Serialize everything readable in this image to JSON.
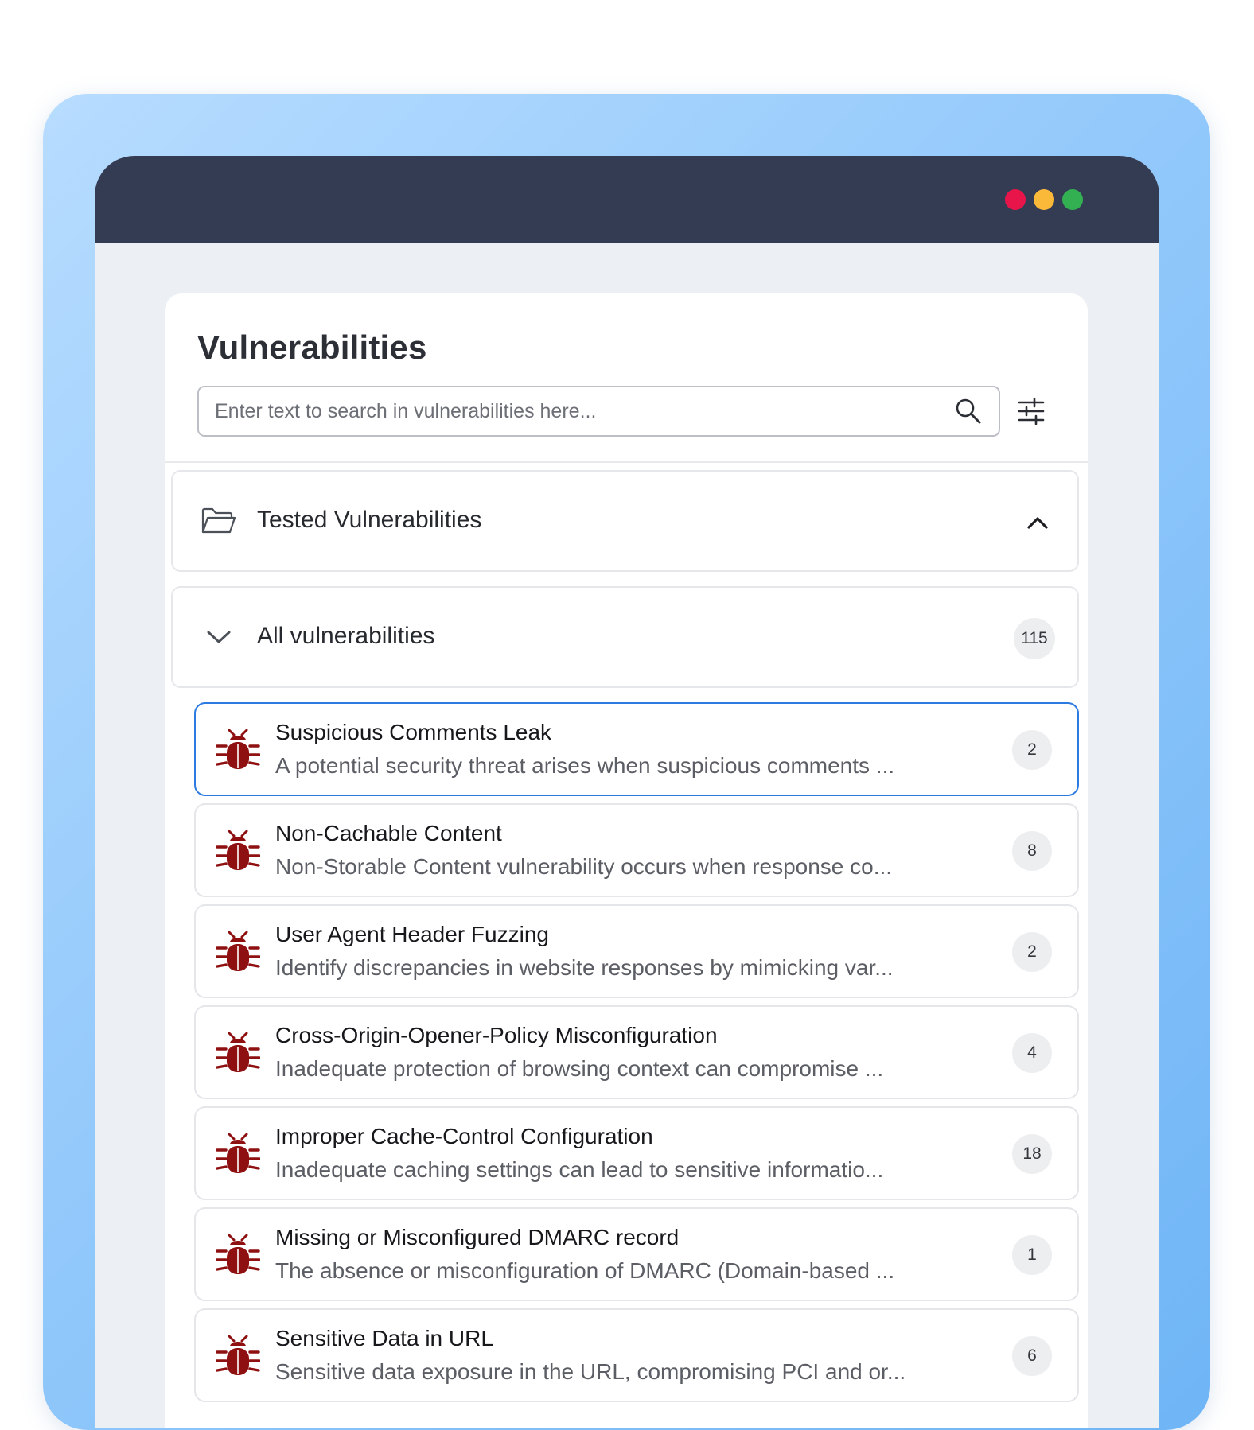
{
  "window": {
    "controls": [
      {
        "name": "close",
        "color": "#e8154a"
      },
      {
        "name": "minimize",
        "color": "#fbb93a"
      },
      {
        "name": "maximize",
        "color": "#33b052"
      }
    ]
  },
  "panel": {
    "title": "Vulnerabilities",
    "search": {
      "placeholder": "Enter text to search in vulnerabilities here...",
      "value": "",
      "icon": "search-icon"
    },
    "filter_icon": "sliders-icon"
  },
  "sections": {
    "tested": {
      "label": "Tested Vulnerabilities",
      "icon": "folder-open-icon",
      "toggle_icon": "chevron-up-icon"
    },
    "all": {
      "label": "All vulnerabilities",
      "icon": "chevron-down-icon",
      "count": "115"
    }
  },
  "vulnerabilities": [
    {
      "title": "Suspicious Comments Leak",
      "description": "A potential security threat arises when suspicious comments ...",
      "count": "2",
      "selected": true
    },
    {
      "title": "Non-Cachable Content",
      "description": "Non-Storable Content vulnerability occurs when response co...",
      "count": "8",
      "selected": false
    },
    {
      "title": "User Agent Header Fuzzing",
      "description": "Identify discrepancies in website responses by mimicking var...",
      "count": "2",
      "selected": false
    },
    {
      "title": "Cross-Origin-Opener-Policy Misconfiguration",
      "description": "Inadequate protection of browsing context can compromise ...",
      "count": "4",
      "selected": false
    },
    {
      "title": "Improper Cache-Control Configuration",
      "description": "Inadequate caching settings can lead to sensitive informatio...",
      "count": "18",
      "selected": false
    },
    {
      "title": "Missing or Misconfigured DMARC record",
      "description": "The absence or misconfiguration of DMARC (Domain-based ...",
      "count": "1",
      "selected": false
    },
    {
      "title": "Sensitive Data in URL",
      "description": "Sensitive data exposure in the URL, compromising PCI and or...",
      "count": "6",
      "selected": false
    }
  ],
  "colors": {
    "bug": "#8e1010",
    "selected_border": "#2d7be0",
    "titlebar": "#343c54"
  }
}
